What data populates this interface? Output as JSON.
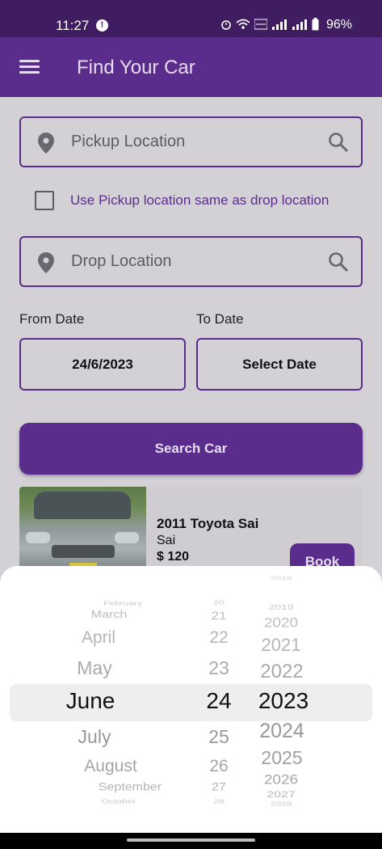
{
  "status_bar": {
    "time": "11:27",
    "alert": "!",
    "battery": "96%"
  },
  "app_bar": {
    "title": "Find Your Car"
  },
  "form": {
    "pickup_placeholder": "Pickup Location",
    "same_location_label": "Use Pickup location same as drop location",
    "same_location_checked": false,
    "drop_placeholder": "Drop Location",
    "from_date_label": "From Date",
    "from_date_value": "24/6/2023",
    "to_date_label": "To Date",
    "to_date_value": "Select Date",
    "search_button": "Search Car"
  },
  "car": {
    "name": "2011 Toyota Sai",
    "model": "Sai",
    "price": "$ 120",
    "book_button": "Book"
  },
  "date_picker": {
    "months": [
      "February",
      "March",
      "April",
      "May",
      "June",
      "July",
      "August",
      "September",
      "October"
    ],
    "days": [
      "20",
      "21",
      "22",
      "23",
      "24",
      "25",
      "26",
      "27",
      "28"
    ],
    "years": [
      "2018",
      "2019",
      "2020",
      "2021",
      "2022",
      "2023",
      "2024",
      "2025",
      "2026",
      "2027",
      "2028"
    ],
    "selected_month": "June",
    "selected_day": "24",
    "selected_year": "2023"
  },
  "colors": {
    "primary": "#5a2d8c",
    "status_bar": "#3f1d60",
    "background": "#d3d0d6"
  }
}
